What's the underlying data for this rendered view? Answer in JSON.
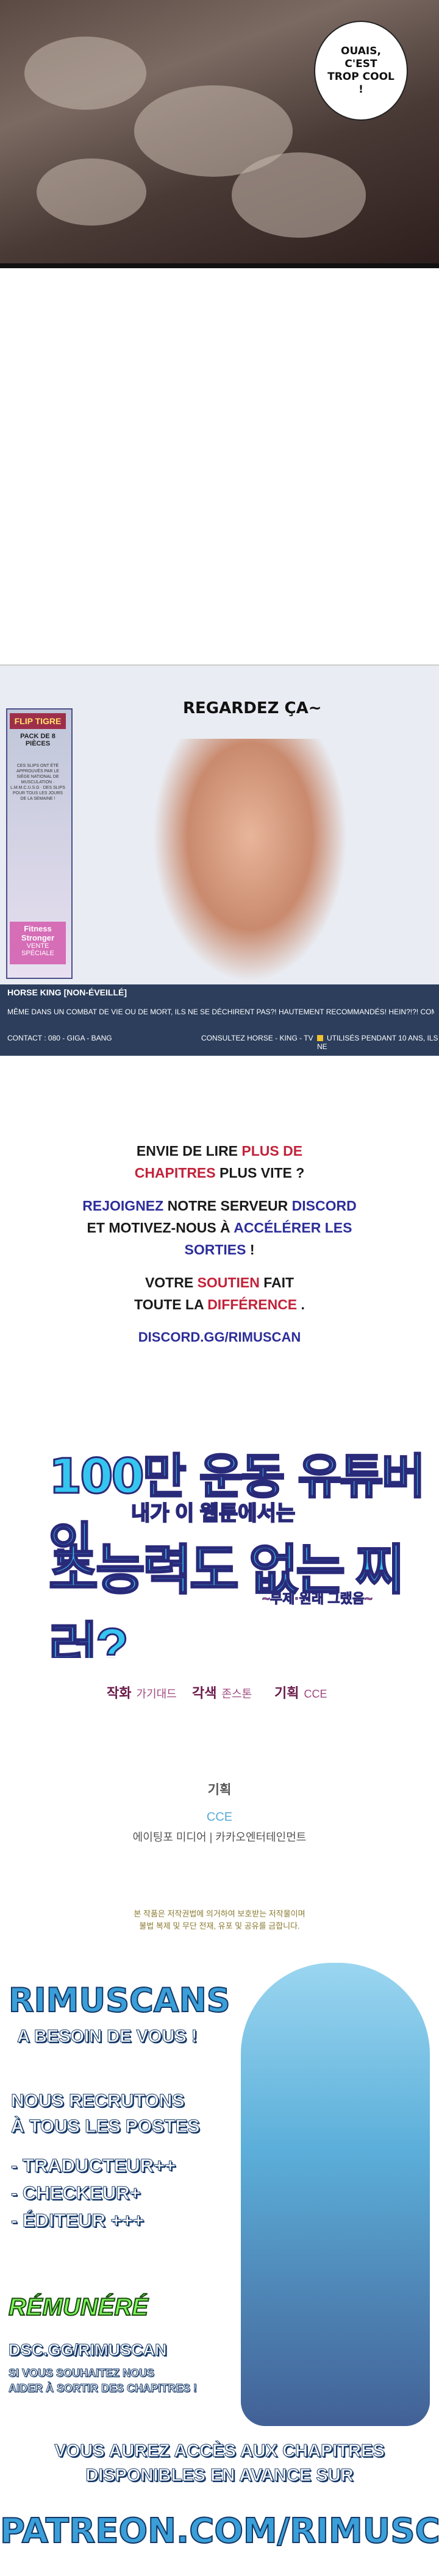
{
  "panel1": {
    "speech": "OUAIS, C'EST TROP COOL !"
  },
  "ad": {
    "flip": "FLIP TIGRE",
    "pack": "PACK DE 8 PIÈCES",
    "pack_sub": "CES SLIPS ONT ÉTÉ APPROUVÉS PAR LE SIÈGE NATIONAL DE MUSCULATION · L.M.M.C.U.S.G · DES SLIPS POUR TOUS LES JOURS DE LA SEMAINE !",
    "fitness": "Fitness Stronger",
    "fitness_sale": "VENTE SPÉCIALE",
    "headline": "REGARDEZ ÇA~",
    "horse_king": "HORSE KING [NON-ÉVEILLÉ]",
    "desc": "MÊME DANS UN COMBAT DE VIE OU DE MORT, ILS NE SE DÉCHIRENT PAS?! HAUTEMENT RECOMMANDÉS! HEIN?!?! COMME ÇA! COMME Ç",
    "contact": "CONTACT : 080 - GIGA - BANG",
    "consult": "CONSULTEZ HORSE - KING - TV",
    "used": "UTILISÉS PENDANT 10 ANS, ILS NE"
  },
  "promo": {
    "l1a": "ENVIE DE LIRE ",
    "l1b": "PLUS DE",
    "l2a": "CHAPITRES",
    "l2b": " PLUS VITE ?",
    "l3a": "REJOIGNEZ",
    "l3b": " NOTRE SERVEUR ",
    "l3c": "DISCORD",
    "l4a": "ET MOTIVEZ-NOUS À ",
    "l4b": "ACCÉLÉRER LES",
    "l5a": "SORTIES",
    "l5b": " !",
    "l6a": "VOTRE ",
    "l6b": "SOUTIEN",
    "l6c": " FAIT",
    "l7a": "TOUTE LA ",
    "l7b": "DIFFÉRENCE",
    "l7c": " .",
    "link": "DISCORD.GG/RIMUSCAN"
  },
  "title": {
    "line1": "100만 운동 유튜버인",
    "line2": "내가 이 웹툰에서는",
    "line3": "초능력도 없는 찌러?",
    "line4": "~부제·원래 그랬음~"
  },
  "credits": {
    "art_label": "작화",
    "art_name": "가기대드",
    "story_label": "각색",
    "story_name": "존스톤",
    "plan_label": "기획",
    "plan_name": "CCE"
  },
  "company": {
    "label": "기획",
    "cce": "CCE",
    "cos": "에이팅포 미디어 | 카카오엔터테인먼트"
  },
  "notice": {
    "l1": "본 작품은 저작권법에 의거하여 보호받는 저작물이며",
    "l2": "불법 복제 및 무단 전재, 유포 및 공유를 금합니다."
  },
  "rimuscans": {
    "name": "RIMUSCANS",
    "sub": "A BESOIN DE VOUS !",
    "recrut1": "NOUS RECRUTONS",
    "recrut2": "À TOUS LES POSTES",
    "role1": "- TRADUCTEUR++",
    "role2": "- CHECKEUR+",
    "role3": "- ÉDITEUR +++",
    "paid": "RÉMUNÉRÉ",
    "dsc": "DSC.GG/RIMUSCAN",
    "dsc2": "SI VOUS SOUHAITEZ NOUS",
    "dsc3": "AIDER À SORTIR DES CHAPITRES !",
    "promo1": "VOUS AUREZ ACCÈS AUX CHAPITRES",
    "promo2": "DISPONIBLES EN AVANCE SUR",
    "patreon": "PATREON.COM/RIMUSCAN"
  }
}
